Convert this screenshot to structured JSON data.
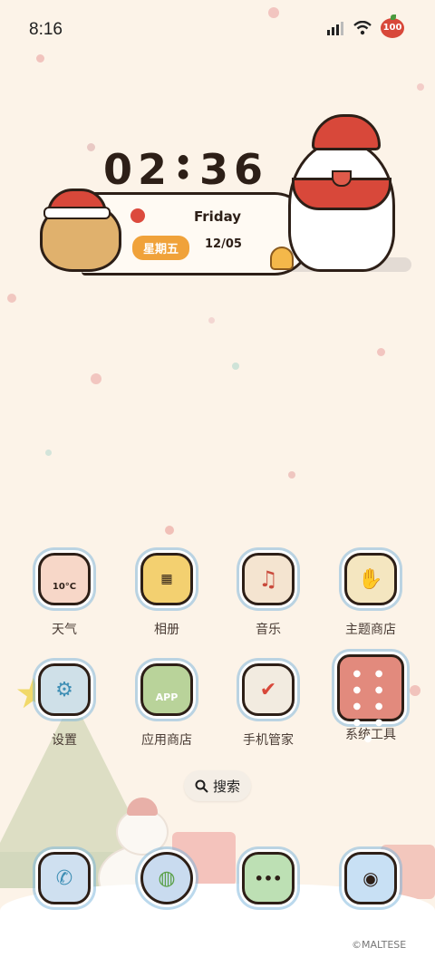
{
  "status_bar": {
    "time": "8:16",
    "battery": "100"
  },
  "widget": {
    "hour": "02",
    "minute": "36",
    "weekday_en": "Friday",
    "weekday_cn": "星期五",
    "date": "12/05"
  },
  "apps_row1": [
    {
      "label": "天气",
      "icon": "weather-icon",
      "badge": "10°C",
      "color": "#f7d7c8"
    },
    {
      "label": "相册",
      "icon": "photo-album-icon",
      "color": "#f3d070"
    },
    {
      "label": "音乐",
      "icon": "music-note-icon",
      "color": "#f4e4d0"
    },
    {
      "label": "主题商店",
      "icon": "mitten-icon",
      "color": "#f4e6c0"
    }
  ],
  "apps_row2": [
    {
      "label": "设置",
      "icon": "settings-icon",
      "color": "#cfe0e8"
    },
    {
      "label": "应用商店",
      "icon": "app-store-icon",
      "badge": "APP",
      "color": "#b9d39a"
    },
    {
      "label": "手机管家",
      "icon": "security-gift-icon",
      "color": "#f2ebe0"
    },
    {
      "label": "系统工具",
      "icon": "folder-icon",
      "color": "#e28a7d"
    }
  ],
  "search": {
    "label": "搜索"
  },
  "dock": [
    {
      "icon": "phone-icon",
      "color": "#cfe0f0"
    },
    {
      "icon": "browser-globe-icon",
      "color": "#c9dbef"
    },
    {
      "icon": "messages-icon",
      "color": "#bde0b4"
    },
    {
      "icon": "camera-icon",
      "color": "#c8e0f4"
    }
  ],
  "credit": "©MALTESE"
}
